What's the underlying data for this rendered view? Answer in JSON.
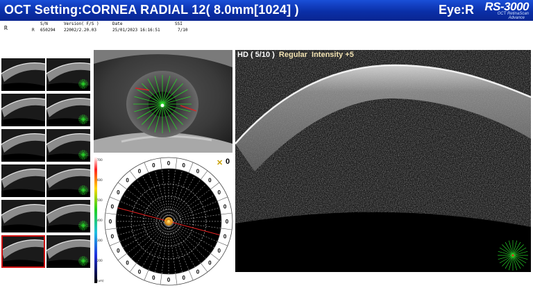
{
  "header": {
    "title": "OCT Setting:CORNEA RADIAL 12( 8.0mm[1024] )",
    "eye": "Eye:R",
    "logo": "RS-3000",
    "logo_sub1": "OCT RetinaScan",
    "logo_sub2": "Advance"
  },
  "info": {
    "eye_label": "R",
    "sn_label": "S/N",
    "sn_value": "650294",
    "version_label": "Version( F/S )",
    "version_value": "22002/2.20.03",
    "date_label": "Date",
    "date_value": "25/01/2023 16:16:51",
    "ssi_label": "SSI",
    "ssi_value": "7/10",
    "row_eye": "R"
  },
  "scan": {
    "head_hd": "HD ( 5/10 )",
    "head_mode": "Regular",
    "head_intensity": "Intensity +5",
    "selected_thumb": 10
  },
  "map": {
    "center_count": "0",
    "cells": [
      "0",
      "0",
      "0",
      "0",
      "0",
      "0",
      "0",
      "0",
      "0",
      "0",
      "0",
      "0",
      "0",
      "0",
      "0",
      "0",
      "0",
      "0",
      "0",
      "0",
      "0",
      "0",
      "0",
      "0"
    ],
    "colorbar_ticks": [
      "700",
      "600",
      "500",
      "400",
      "300",
      "200",
      "(um)"
    ]
  }
}
